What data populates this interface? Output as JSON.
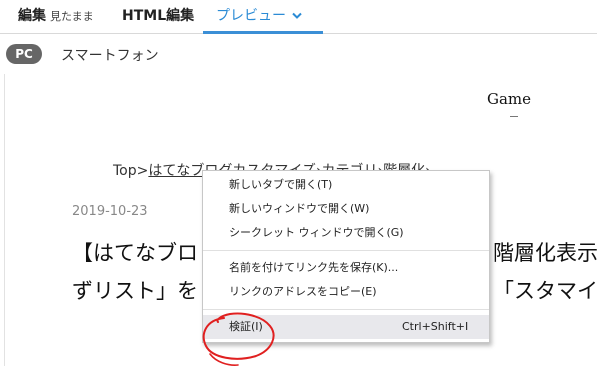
{
  "tabs": {
    "edit_label": "編集",
    "edit_sub": "見たまま",
    "html_label": "HTML編集",
    "preview_label": "プレビュー"
  },
  "device": {
    "pc": "PC",
    "smartphone": "スマートフォン"
  },
  "preview": {
    "site_title": "Game",
    "breadcrumb_top": "Top",
    "breadcrumb_sep": ">",
    "breadcrumb_link": "はてなブログカスタマイズ",
    "breadcrumb_rest": "›カテゴリ›階層化›",
    "date": "2019-10-23",
    "title_line1": "【はてなブロ",
    "title_line1_tail": "階層化表示",
    "title_line2": "ずリスト」を",
    "title_line2_tail": "「スタマイズ"
  },
  "context_menu": {
    "items": [
      {
        "label": "新しいタブで開く(T)"
      },
      {
        "label": "新しいウィンドウで開く(W)"
      },
      {
        "label": "シークレット ウィンドウで開く(G)"
      },
      {
        "label": "名前を付けてリンク先を保存(K)..."
      },
      {
        "label": "リンクのアドレスをコピー(E)"
      },
      {
        "label": "検証(I)",
        "shortcut": "Ctrl+Shift+I"
      }
    ]
  },
  "colors": {
    "accent": "#2b8bd5",
    "pill": "#666666",
    "annotation": "#e02020"
  }
}
